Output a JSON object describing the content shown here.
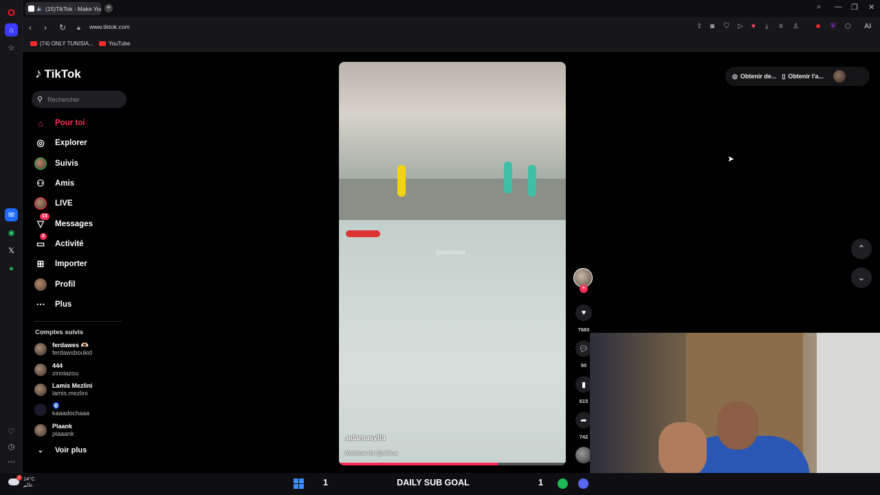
{
  "browser": {
    "tab_title": "(15)TikTok - Make You",
    "url": "www.tiktok.com",
    "bookmarks": [
      "(74) ONLY TUNISIA...",
      "YouTube"
    ],
    "ai_label": "AI"
  },
  "tiktok": {
    "logo": "TikTok",
    "search_placeholder": "Rechercher",
    "nav": [
      {
        "label": "Pour toi",
        "icon": "home-icon",
        "active": true
      },
      {
        "label": "Explorer",
        "icon": "compass-icon"
      },
      {
        "label": "Suivis",
        "icon": "following-avatar-icon"
      },
      {
        "label": "Amis",
        "icon": "friends-icon"
      },
      {
        "label": "LIVE",
        "icon": "live-icon"
      },
      {
        "label": "Messages",
        "icon": "messages-icon",
        "badge": "13"
      },
      {
        "label": "Activité",
        "icon": "activity-icon",
        "badge": "2"
      },
      {
        "label": "Importer",
        "icon": "upload-icon"
      },
      {
        "label": "Profil",
        "icon": "profile-avatar-icon"
      },
      {
        "label": "Plus",
        "icon": "more-icon"
      }
    ],
    "following_title": "Comptes suivis",
    "following": [
      {
        "name": "ferdawes 🫶🏻",
        "handle": "ferdawsboukid"
      },
      {
        "name": "444",
        "handle": "zinniazou"
      },
      {
        "name": "Lamis Mezlini",
        "handle": "lamis.mezlini"
      },
      {
        "name": "🧿",
        "handle": "kaaadochaaa"
      },
      {
        "name": "Plaank",
        "handle": "plaaank"
      }
    ],
    "see_more": "Voir plus",
    "video": {
      "username": ".adamasylla",
      "caption": "Abonne-toi @africa",
      "watermark": "@pelotada",
      "progress": 0.7
    },
    "actions": {
      "likes": "7683",
      "comments": "50",
      "saves": "615",
      "shares": "742"
    },
    "top_right": {
      "get_coins": "Obtenir de...",
      "get_app": "Obtenir l'a..."
    }
  },
  "taskbar": {
    "temperature": "14°C",
    "weather_text": "عالم",
    "weather_badge": "2",
    "goal_left": "1",
    "goal_label": "DAILY SUB GOAL",
    "goal_right": "1"
  },
  "colors": {
    "accent": "#fe2c55",
    "opera": "#ff1b2d"
  }
}
